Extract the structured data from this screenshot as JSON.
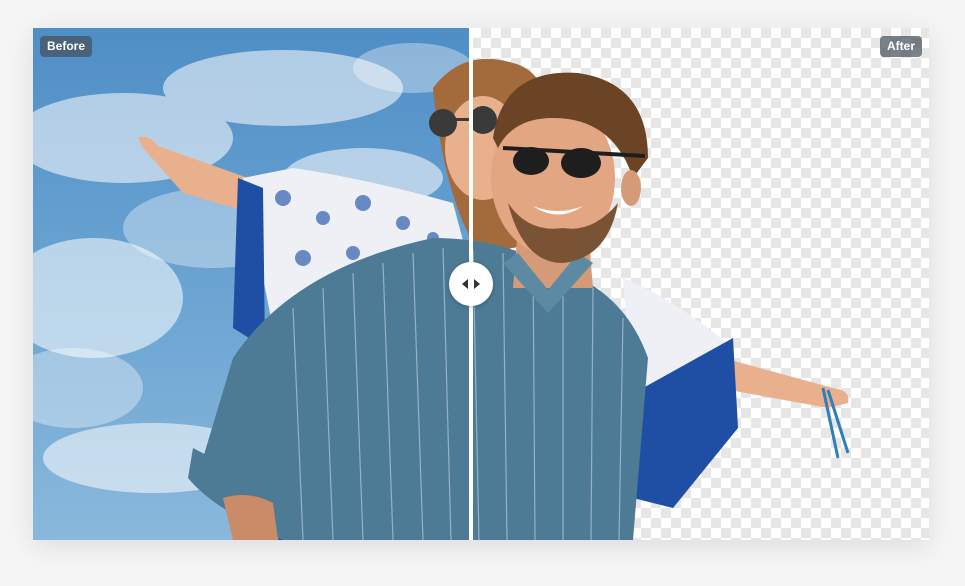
{
  "comparison": {
    "before_label": "Before",
    "after_label": "After",
    "slider_position_percent": 49
  },
  "icons": {
    "handle": "left-right-arrows-icon"
  },
  "colors": {
    "sky": "#5f9ccd",
    "checker": "#e6e6e6",
    "label_bg": "#46505c",
    "divider": "#ffffff"
  }
}
